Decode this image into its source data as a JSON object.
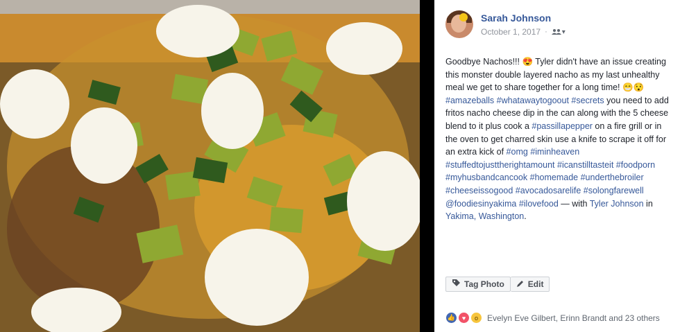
{
  "post": {
    "author": "Sarah Johnson",
    "date": "October 1, 2017",
    "audience_icon": "friends-icon",
    "text_segments": [
      {
        "t": "Goodbye Nachos!!! 😍 Tyler didn't have an issue creating this monster double layered nacho as my last unhealthy meal we get to share together for a long time! 😁😯 ",
        "link": false
      },
      {
        "t": "#amazeballs",
        "link": true
      },
      {
        "t": " ",
        "link": false
      },
      {
        "t": "#whatawaytogoout",
        "link": true
      },
      {
        "t": " ",
        "link": false
      },
      {
        "t": "#secrets",
        "link": true
      },
      {
        "t": " you need to add fritos nacho cheese dip in the can along with the 5 cheese blend to it plus cook a ",
        "link": false
      },
      {
        "t": "#passillapepper",
        "link": true
      },
      {
        "t": " on a fire grill or in the oven to get charred skin use a knife to scrape it off for an extra kick of ",
        "link": false
      },
      {
        "t": "#omg",
        "link": true
      },
      {
        "t": " ",
        "link": false
      },
      {
        "t": "#iminheaven",
        "link": true
      },
      {
        "t": " ",
        "link": false
      },
      {
        "t": "#stuffedtojusttherightamount",
        "link": true
      },
      {
        "t": " ",
        "link": false
      },
      {
        "t": "#icanstilltasteit",
        "link": true
      },
      {
        "t": " ",
        "link": false
      },
      {
        "t": "#foodporn",
        "link": true
      },
      {
        "t": " ",
        "link": false
      },
      {
        "t": "#myhusbandcancook",
        "link": true
      },
      {
        "t": " ",
        "link": false
      },
      {
        "t": "#homemade",
        "link": true
      },
      {
        "t": " ",
        "link": false
      },
      {
        "t": "#underthebroiler",
        "link": true
      },
      {
        "t": " ",
        "link": false
      },
      {
        "t": "#cheeseissogood",
        "link": true
      },
      {
        "t": " ",
        "link": false
      },
      {
        "t": "#avocadosarelife",
        "link": true
      },
      {
        "t": " ",
        "link": false
      },
      {
        "t": "#solongfarewell",
        "link": true
      },
      {
        "t": " ",
        "link": false
      },
      {
        "t": "@foodiesinyakima",
        "link": true
      },
      {
        "t": " ",
        "link": false
      },
      {
        "t": "#ilovefood",
        "link": true
      },
      {
        "t": " — with ",
        "link": false
      },
      {
        "t": "Tyler Johnson",
        "link": true
      },
      {
        "t": " in ",
        "link": false
      },
      {
        "t": "Yakima, Washington",
        "link": true
      },
      {
        "t": ".",
        "link": false
      }
    ]
  },
  "actions": {
    "tag_photo": "Tag Photo",
    "edit": "Edit"
  },
  "reactions": {
    "summary": "Evelyn Eve Gilbert, Erinn Brandt and 23 others",
    "icons": [
      "like-icon",
      "love-icon",
      "wow-icon"
    ]
  },
  "colors": {
    "link": "#365899",
    "text": "#1d2129",
    "meta": "#90949c"
  }
}
